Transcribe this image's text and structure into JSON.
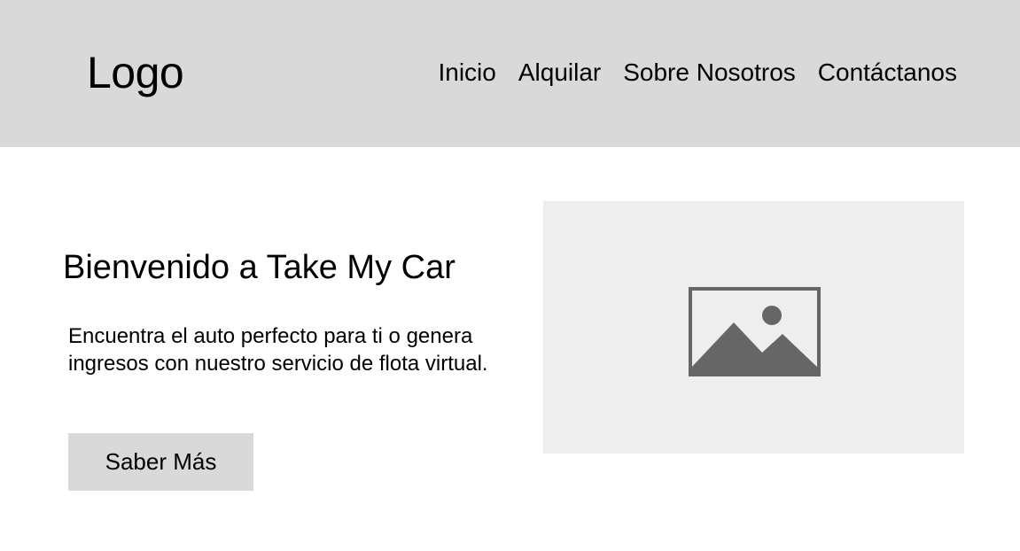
{
  "header": {
    "logo": "Logo",
    "nav": [
      {
        "label": "Inicio"
      },
      {
        "label": "Alquilar"
      },
      {
        "label": "Sobre Nosotros"
      },
      {
        "label": "Contáctanos"
      }
    ]
  },
  "hero": {
    "title": "Bienvenido a Take My Car",
    "description": "Encuentra el auto perfecto para ti o genera ingresos con nuestro servicio de flota virtual.",
    "cta_label": "Saber Más",
    "image_icon": "image-placeholder-icon"
  },
  "colors": {
    "header_bg": "#d9d9d9",
    "button_bg": "#d9d9d9",
    "image_bg": "#eeeeee",
    "icon": "#666666"
  }
}
